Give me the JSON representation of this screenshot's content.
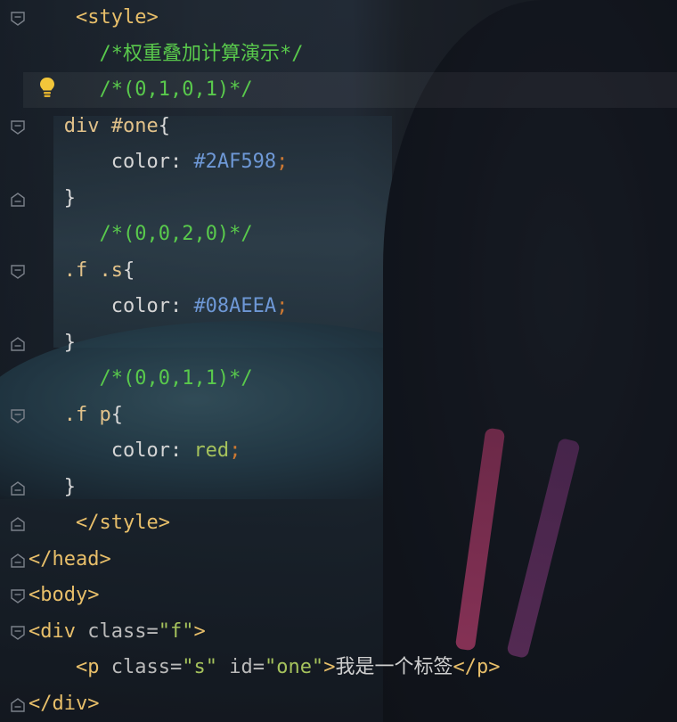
{
  "code_lines": [
    {
      "indent": "    ",
      "parts": [
        {
          "t": "<style>",
          "c": "tag"
        }
      ]
    },
    {
      "indent": "      ",
      "parts": [
        {
          "t": "/*权重叠加计算演示*/",
          "c": "comment"
        }
      ]
    },
    {
      "indent": "      ",
      "parts": [
        {
          "t": "/*(0,1,0,1)*/",
          "c": "comment"
        }
      ]
    },
    {
      "indent": "   ",
      "parts": [
        {
          "t": "div #one",
          "c": "sel"
        },
        {
          "t": "{",
          "c": "brace"
        }
      ]
    },
    {
      "indent": "       ",
      "parts": [
        {
          "t": "color: ",
          "c": "prop"
        },
        {
          "t": "#2AF598",
          "c": "hex"
        },
        {
          "t": ";",
          "c": "semi"
        }
      ]
    },
    {
      "indent": "   ",
      "parts": [
        {
          "t": "}",
          "c": "brace"
        }
      ]
    },
    {
      "indent": "      ",
      "parts": [
        {
          "t": "/*(0,0,2,0)*/",
          "c": "comment"
        }
      ]
    },
    {
      "indent": "   ",
      "parts": [
        {
          "t": ".f .s",
          "c": "sel"
        },
        {
          "t": "{",
          "c": "brace"
        }
      ]
    },
    {
      "indent": "       ",
      "parts": [
        {
          "t": "color: ",
          "c": "prop"
        },
        {
          "t": "#08AEEA",
          "c": "hex"
        },
        {
          "t": ";",
          "c": "semi"
        }
      ]
    },
    {
      "indent": "   ",
      "parts": [
        {
          "t": "}",
          "c": "brace"
        }
      ]
    },
    {
      "indent": "      ",
      "parts": [
        {
          "t": "/*(0,0,1,1)*/",
          "c": "comment"
        }
      ]
    },
    {
      "indent": "   ",
      "parts": [
        {
          "t": ".f p",
          "c": "sel"
        },
        {
          "t": "{",
          "c": "brace"
        }
      ]
    },
    {
      "indent": "       ",
      "parts": [
        {
          "t": "color: ",
          "c": "prop"
        },
        {
          "t": "red",
          "c": "val"
        },
        {
          "t": ";",
          "c": "semi"
        }
      ]
    },
    {
      "indent": "   ",
      "parts": [
        {
          "t": "}",
          "c": "brace"
        }
      ]
    },
    {
      "indent": "    ",
      "parts": [
        {
          "t": "</style>",
          "c": "tag"
        }
      ]
    },
    {
      "indent": "",
      "parts": [
        {
          "t": "</head>",
          "c": "tag"
        }
      ]
    },
    {
      "indent": "",
      "parts": [
        {
          "t": "<body>",
          "c": "tag"
        }
      ]
    },
    {
      "indent": "",
      "parts": [
        {
          "t": "<div ",
          "c": "tag"
        },
        {
          "t": "class=",
          "c": "attr"
        },
        {
          "t": "\"f\"",
          "c": "str"
        },
        {
          "t": ">",
          "c": "tag"
        }
      ]
    },
    {
      "indent": "    ",
      "parts": [
        {
          "t": "<p ",
          "c": "tag"
        },
        {
          "t": "class=",
          "c": "attr"
        },
        {
          "t": "\"s\" ",
          "c": "str"
        },
        {
          "t": "id=",
          "c": "attr"
        },
        {
          "t": "\"one\"",
          "c": "str"
        },
        {
          "t": ">",
          "c": "tag"
        },
        {
          "t": "我是一个标签",
          "c": "text"
        },
        {
          "t": "</p>",
          "c": "tag"
        }
      ]
    },
    {
      "indent": "",
      "parts": [
        {
          "t": "</div>",
          "c": "tag"
        }
      ]
    }
  ],
  "fold_markers": [
    "open",
    "none",
    "none",
    "open",
    "none",
    "close",
    "none",
    "open",
    "none",
    "close",
    "none",
    "open",
    "none",
    "close",
    "close",
    "close",
    "open",
    "open",
    "none",
    "close"
  ],
  "icons": {
    "intention_bulb": "lightbulb-icon",
    "fold": "fold-marker-icon"
  },
  "colors": {
    "tag": "#e8bf6a",
    "comment": "#59c94c",
    "hex": "#6e98d6",
    "semi": "#cc7832",
    "val": "#a5c25c"
  }
}
